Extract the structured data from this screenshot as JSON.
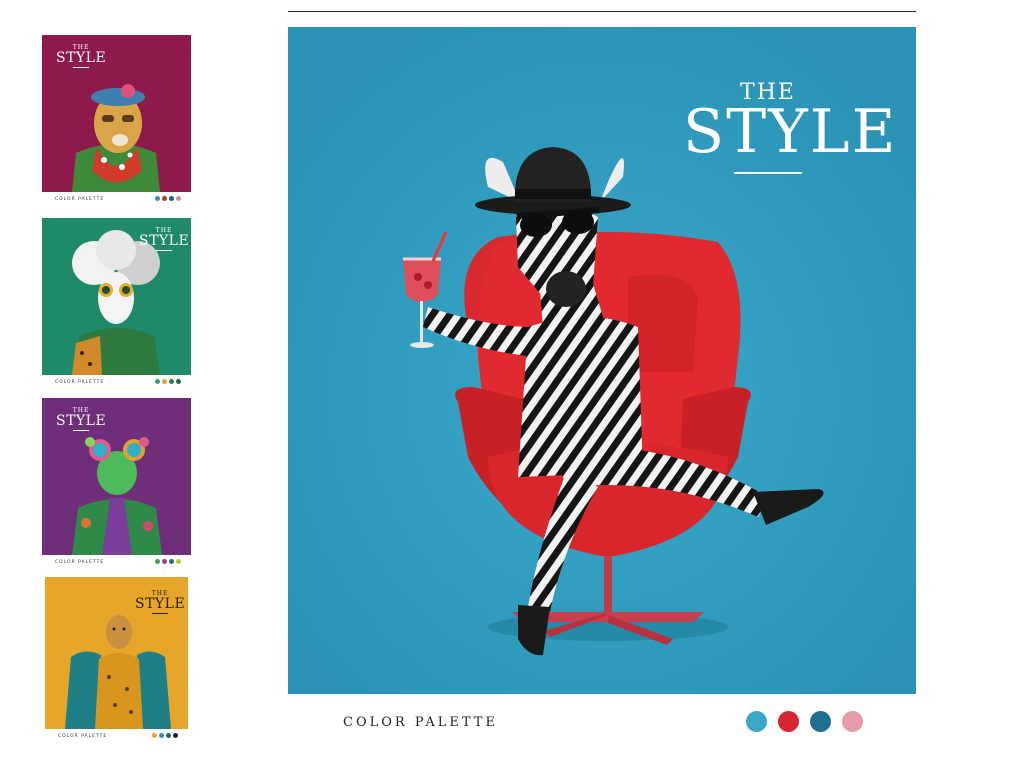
{
  "thumbnails": [
    {
      "the": "THE",
      "style": "STYLE",
      "caption": "COLOR PALETTE",
      "background": "#8e1a4c",
      "palette": [
        "#3a8fb3",
        "#c0303a",
        "#1f5f7a",
        "#d98aa0"
      ]
    },
    {
      "the": "THE",
      "style": "STYLE",
      "caption": "COLOR PALETTE",
      "background": "#1f8a6a",
      "palette": [
        "#3a9b7a",
        "#e3a43c",
        "#2f7d4c",
        "#166b4a"
      ]
    },
    {
      "the": "THE",
      "style": "STYLE",
      "caption": "COLOR PALETTE",
      "background": "#6e2e7a",
      "palette": [
        "#3d9c60",
        "#8d3fa0",
        "#2a6a7a",
        "#b8c830"
      ]
    },
    {
      "the": "THE",
      "style": "STYLE",
      "caption": "COLOR PALETTE",
      "background": "#e6a62a",
      "palette": [
        "#e8a52f",
        "#2f8fb8",
        "#1f6a6f",
        "#222222"
      ]
    }
  ],
  "poster": {
    "the": "THE",
    "style": "STYLE",
    "caption": "COLOR PALETTE",
    "background": "#2f9cbf",
    "palette": [
      "#3aa6c8",
      "#d6262f",
      "#1f6f90",
      "#e79aa9"
    ]
  }
}
